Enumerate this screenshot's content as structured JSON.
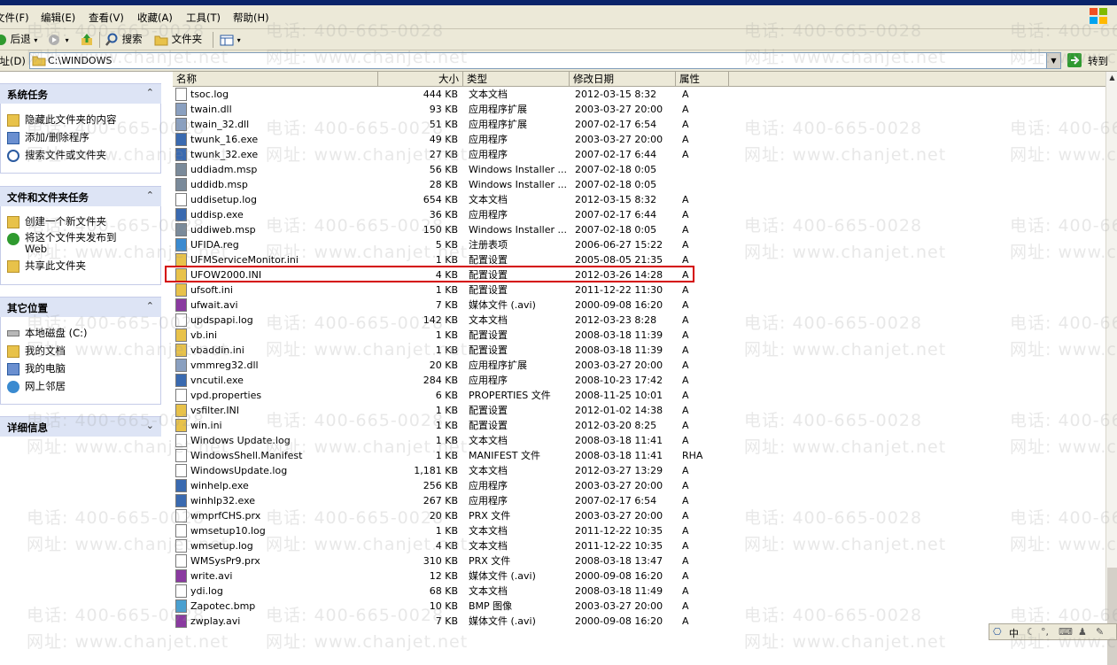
{
  "window": {
    "title": "C:\\WINDOWS"
  },
  "menu": [
    "文件(F)",
    "编辑(E)",
    "查看(V)",
    "收藏(A)",
    "工具(T)",
    "帮助(H)"
  ],
  "toolbar": {
    "back": "后退",
    "search": "搜索",
    "folders": "文件夹"
  },
  "address": {
    "label": "地址(D)",
    "value": "C:\\WINDOWS",
    "go": "转到"
  },
  "left_panels": [
    {
      "title": "系统任务",
      "items": [
        "隐藏此文件夹的内容",
        "添加/删除程序",
        "搜索文件或文件夹"
      ]
    },
    {
      "title": "文件和文件夹任务",
      "items": [
        "创建一个新文件夹",
        "将这个文件夹发布到 Web",
        "共享此文件夹"
      ]
    },
    {
      "title": "其它位置",
      "items": [
        "本地磁盘 (C:)",
        "我的文档",
        "我的电脑",
        "网上邻居"
      ]
    },
    {
      "title": "详细信息",
      "items": []
    }
  ],
  "columns": [
    "名称",
    "大小",
    "类型",
    "修改日期",
    "属性"
  ],
  "files": [
    {
      "name": "tsoc.log",
      "size": "444 KB",
      "type": "文本文档",
      "date": "2012-03-15 8:32",
      "attr": "A"
    },
    {
      "name": "twain.dll",
      "size": "93 KB",
      "type": "应用程序扩展",
      "date": "2003-03-27 20:00",
      "attr": "A"
    },
    {
      "name": "twain_32.dll",
      "size": "51 KB",
      "type": "应用程序扩展",
      "date": "2007-02-17 6:54",
      "attr": "A"
    },
    {
      "name": "twunk_16.exe",
      "size": "49 KB",
      "type": "应用程序",
      "date": "2003-03-27 20:00",
      "attr": "A"
    },
    {
      "name": "twunk_32.exe",
      "size": "27 KB",
      "type": "应用程序",
      "date": "2007-02-17 6:44",
      "attr": "A"
    },
    {
      "name": "uddiadm.msp",
      "size": "56 KB",
      "type": "Windows Installer ...",
      "date": "2007-02-18 0:05",
      "attr": ""
    },
    {
      "name": "uddidb.msp",
      "size": "28 KB",
      "type": "Windows Installer ...",
      "date": "2007-02-18 0:05",
      "attr": ""
    },
    {
      "name": "uddisetup.log",
      "size": "654 KB",
      "type": "文本文档",
      "date": "2012-03-15 8:32",
      "attr": "A"
    },
    {
      "name": "uddisp.exe",
      "size": "36 KB",
      "type": "应用程序",
      "date": "2007-02-17 6:44",
      "attr": "A"
    },
    {
      "name": "uddiweb.msp",
      "size": "150 KB",
      "type": "Windows Installer ...",
      "date": "2007-02-18 0:05",
      "attr": "A"
    },
    {
      "name": "UFIDA.reg",
      "size": "5 KB",
      "type": "注册表项",
      "date": "2006-06-27 15:22",
      "attr": "A"
    },
    {
      "name": "UFMServiceMonitor.ini",
      "size": "1 KB",
      "type": "配置设置",
      "date": "2005-08-05 21:35",
      "attr": "A"
    },
    {
      "name": "UFOW2000.INI",
      "size": "4 KB",
      "type": "配置设置",
      "date": "2012-03-26 14:28",
      "attr": "A"
    },
    {
      "name": "ufsoft.ini",
      "size": "1 KB",
      "type": "配置设置",
      "date": "2011-12-22 11:30",
      "attr": "A"
    },
    {
      "name": "ufwait.avi",
      "size": "7 KB",
      "type": "媒体文件 (.avi)",
      "date": "2000-09-08 16:20",
      "attr": "A"
    },
    {
      "name": "updspapi.log",
      "size": "142 KB",
      "type": "文本文档",
      "date": "2012-03-23 8:28",
      "attr": "A"
    },
    {
      "name": "vb.ini",
      "size": "1 KB",
      "type": "配置设置",
      "date": "2008-03-18 11:39",
      "attr": "A"
    },
    {
      "name": "vbaddin.ini",
      "size": "1 KB",
      "type": "配置设置",
      "date": "2008-03-18 11:39",
      "attr": "A"
    },
    {
      "name": "vmmreg32.dll",
      "size": "20 KB",
      "type": "应用程序扩展",
      "date": "2003-03-27 20:00",
      "attr": "A"
    },
    {
      "name": "vncutil.exe",
      "size": "284 KB",
      "type": "应用程序",
      "date": "2008-10-23 17:42",
      "attr": "A"
    },
    {
      "name": "vpd.properties",
      "size": "6 KB",
      "type": "PROPERTIES 文件",
      "date": "2008-11-25 10:01",
      "attr": "A"
    },
    {
      "name": "vsfilter.INI",
      "size": "1 KB",
      "type": "配置设置",
      "date": "2012-01-02 14:38",
      "attr": "A"
    },
    {
      "name": "win.ini",
      "size": "1 KB",
      "type": "配置设置",
      "date": "2012-03-20 8:25",
      "attr": "A"
    },
    {
      "name": "Windows Update.log",
      "size": "1 KB",
      "type": "文本文档",
      "date": "2008-03-18 11:41",
      "attr": "A"
    },
    {
      "name": "WindowsShell.Manifest",
      "size": "1 KB",
      "type": "MANIFEST 文件",
      "date": "2008-03-18 11:41",
      "attr": "RHA"
    },
    {
      "name": "WindowsUpdate.log",
      "size": "1,181 KB",
      "type": "文本文档",
      "date": "2012-03-27 13:29",
      "attr": "A"
    },
    {
      "name": "winhelp.exe",
      "size": "256 KB",
      "type": "应用程序",
      "date": "2003-03-27 20:00",
      "attr": "A"
    },
    {
      "name": "winhlp32.exe",
      "size": "267 KB",
      "type": "应用程序",
      "date": "2007-02-17 6:54",
      "attr": "A"
    },
    {
      "name": "wmprfCHS.prx",
      "size": "20 KB",
      "type": "PRX 文件",
      "date": "2003-03-27 20:00",
      "attr": "A"
    },
    {
      "name": "wmsetup10.log",
      "size": "1 KB",
      "type": "文本文档",
      "date": "2011-12-22 10:35",
      "attr": "A"
    },
    {
      "name": "wmsetup.log",
      "size": "4 KB",
      "type": "文本文档",
      "date": "2011-12-22 10:35",
      "attr": "A"
    },
    {
      "name": "WMSysPr9.prx",
      "size": "310 KB",
      "type": "PRX 文件",
      "date": "2008-03-18 13:47",
      "attr": "A"
    },
    {
      "name": "write.avi",
      "size": "12 KB",
      "type": "媒体文件 (.avi)",
      "date": "2000-09-08 16:20",
      "attr": "A"
    },
    {
      "name": "ydi.log",
      "size": "68 KB",
      "type": "文本文档",
      "date": "2008-03-18 11:49",
      "attr": "A"
    },
    {
      "name": "Zapotec.bmp",
      "size": "10 KB",
      "type": "BMP 图像",
      "date": "2003-03-27 20:00",
      "attr": "A"
    },
    {
      "name": "zwplay.avi",
      "size": "7 KB",
      "type": "媒体文件 (.avi)",
      "date": "2000-09-08 16:20",
      "attr": "A"
    }
  ],
  "watermark": {
    "phone": "电话: 400-665-0028",
    "site": "网址: www.chanjet.net"
  },
  "ime": {
    "label": "中"
  },
  "colors": {
    "highlight": "#d40000",
    "panel_header": "#dde4f5",
    "chrome": "#ece9d8"
  }
}
